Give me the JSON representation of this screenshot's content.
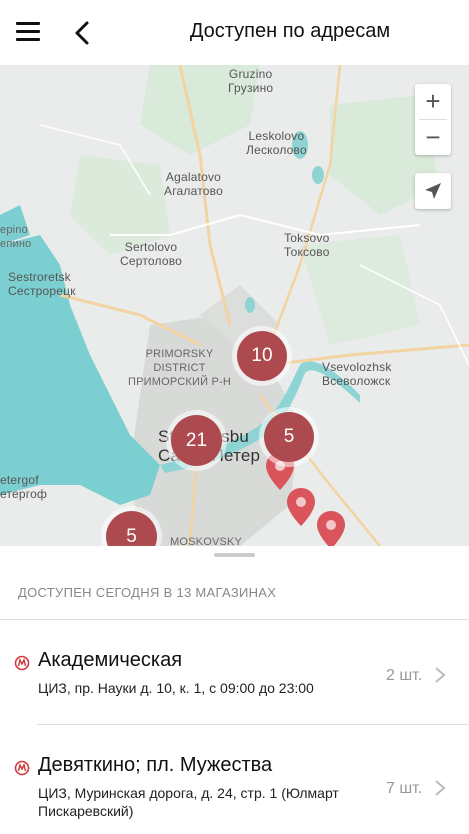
{
  "header": {
    "title": "Доступен по адресам"
  },
  "map": {
    "labels": [
      {
        "id": "gruzino",
        "text": "Gruzino\nГрузино"
      },
      {
        "id": "leskolovo",
        "text": "Leskolovo\nЛесколово"
      },
      {
        "id": "agalatovo",
        "text": "Agalatovo\nАгалатово"
      },
      {
        "id": "sertolovo",
        "text": "Sertolovo\nСертолово"
      },
      {
        "id": "toksovo",
        "text": "Toksovo\nТоксово"
      },
      {
        "id": "sestroretsk",
        "text": "Sestroretsk\nСестрорецк"
      },
      {
        "id": "primorsky",
        "text": "PRIMORSKY\nDISTRICT\nПРИМОРСКИЙ Р-Н"
      },
      {
        "id": "vsevolozhsk",
        "text": "Vsevolozhsk\nВсеволожск"
      },
      {
        "id": "spb",
        "text": "St Petersbu\nСанкт-Петер"
      },
      {
        "id": "peterhof",
        "text": "etergof\nетергоф"
      },
      {
        "id": "repino",
        "text": "ерino\nепино"
      },
      {
        "id": "moskovsky",
        "text": "MOSKOVSKY"
      }
    ],
    "clusters": [
      {
        "id": "c10",
        "count": "10"
      },
      {
        "id": "c21",
        "count": "21"
      },
      {
        "id": "c5a",
        "count": "5"
      },
      {
        "id": "c5b",
        "count": "5"
      }
    ],
    "zoom_in": "+",
    "zoom_out": "−",
    "colors": {
      "water": "#7ccfd0",
      "land": "#e9ecea",
      "urban": "#d7d9d6",
      "green": "#cfe6cf",
      "road": "#f4cf9a",
      "cluster": "#ad4a4f",
      "pin": "#d9555b"
    }
  },
  "list": {
    "section_title": "ДОСТУПЕН СЕГОДНЯ В 13 МАГАЗИНАХ",
    "stores": [
      {
        "name": "Академическая",
        "address": "ЦИЗ, пр. Науки д. 10, к. 1, с 09:00 до 23:00",
        "qty": "2 шт."
      },
      {
        "name": "Девяткино; пл. Мужества",
        "address": "ЦИЗ, Муринская дорога, д. 24, стр. 1 (Юлмарт Пискаревский)",
        "qty": "7 шт."
      }
    ]
  }
}
